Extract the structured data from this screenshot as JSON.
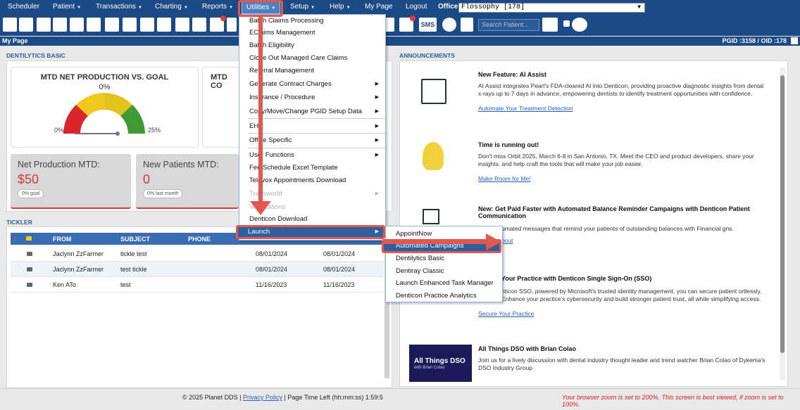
{
  "nav": {
    "items": [
      "Scheduler",
      "Patient",
      "Transactions",
      "Charting",
      "Reports",
      "Utilities",
      "Setup",
      "Help",
      "My Page",
      "Logout"
    ],
    "office_label": "Office",
    "office_value": "Flossophy [178]"
  },
  "toolbar": {
    "search_placeholder": "Search Patient...",
    "badge_sms": "SMS"
  },
  "page": {
    "title": "My Page",
    "ids": "PGID :3158  /  OID :178"
  },
  "dentilytics": {
    "section": "DENTILYTICS BASIC",
    "gauge1_title": "MTD NET PRODUCTION VS. GOAL",
    "gauge1_pct": "0%",
    "gauge1_min": "0%",
    "gauge1_max": "25%",
    "gauge2_title": "MTD CO",
    "kpi1_label": "Net Production MTD:",
    "kpi1_value": "$50",
    "kpi1_pill": "0% goal",
    "kpi2_label": "New Patients MTD:",
    "kpi2_value": "0",
    "kpi2_pill": "0% last month"
  },
  "tickler": {
    "section": "TICKLER",
    "cols": [
      "FROM",
      "SUBJECT",
      "PHONE"
    ],
    "rows": [
      {
        "from": "Jaclynn ZzFarmer",
        "subject": "tickle test",
        "d1": "08/01/2024",
        "d2": "08/01/2024"
      },
      {
        "from": "Jaclynn ZzFarmer",
        "subject": "test tickle",
        "d1": "08/01/2024",
        "d2": "08/01/2024"
      },
      {
        "from": "Ken ATo",
        "subject": "test",
        "d1": "11/16/2023",
        "d2": "11/16/2023"
      }
    ]
  },
  "announcements": {
    "section": "ANNOUNCEMENTS",
    "items": [
      {
        "title": "New Feature: AI Assist",
        "body": "AI Assist integrates Pearl's FDA-cleared AI into Denticon, providing proactive diagnostic insights from dental x-rays up to 7 days in advance, empowering dentists to identify treatment opportunities with confidence.",
        "link": "Automate Your Treatment Detection"
      },
      {
        "title": "Time is running out!",
        "body": "Don't miss Orbit 2025, March 6-8 in San Antonio, TX. Meet the CEO and product developers, share your insights, and help craft the tools that will make your job easier.",
        "link": "Make Room for Me!"
      },
      {
        "title": "New: Get Paid Faster with Automated Balance Reminder Campaigns with Denticon Patient Communication",
        "body": "omated messages that remind your patients of outstanding balances with Financial gns.",
        "link": "bout"
      },
      {
        "title": "Your Practice with Denticon Single Sign-On (SSO)",
        "body": "nticon SSO, powered by Microsoft's trusted identity management, you can secure patient ortlessly. Enhance your practice's cybersecurity and build stronger patient trust, all while simplifying access.",
        "link": "Secure Your Practice"
      },
      {
        "title": "All Things DSO with Brian Colao",
        "body": "Join us for a lively discussion with dental industry thought leader and trend watcher Brian Colao of Dykema's DSO Industry Group",
        "link": ""
      }
    ],
    "dso_img_title": "All Things DSO",
    "dso_img_sub": "with Brian Colao"
  },
  "utilities_menu": {
    "items": [
      "Batch Claims Processing",
      "EClaims Management",
      "Batch Eligibility",
      "Close Out Managed Care Claims",
      "Referral Management",
      "Generate Contract Charges",
      "Insurance / Procedure",
      "Copy/Move/Change PGID Setup Data",
      "EHR",
      "Office Specific",
      "User Functions",
      "Fee Schedule Excel Template",
      "Televox Appointments Download",
      "Transworld",
      "Verifications",
      "Denticon Download",
      "Launch"
    ]
  },
  "launch_menu": {
    "items": [
      "AppointNow",
      "Automated Campaigns",
      "Dentilytics Basic",
      "Dentiray Classic",
      "Launch Enhanced Task Manager",
      "Denticon Practice Analytics"
    ]
  },
  "footer": {
    "copyright": "© 2025 Planet DDS | ",
    "privacy": "Privacy Policy",
    "time": " | Page Time Left (hh:mm:ss) 1:59:5",
    "warning": "Your browser zoom is set to 200%. This screen is best viewed, if zoom is set to 100%."
  }
}
